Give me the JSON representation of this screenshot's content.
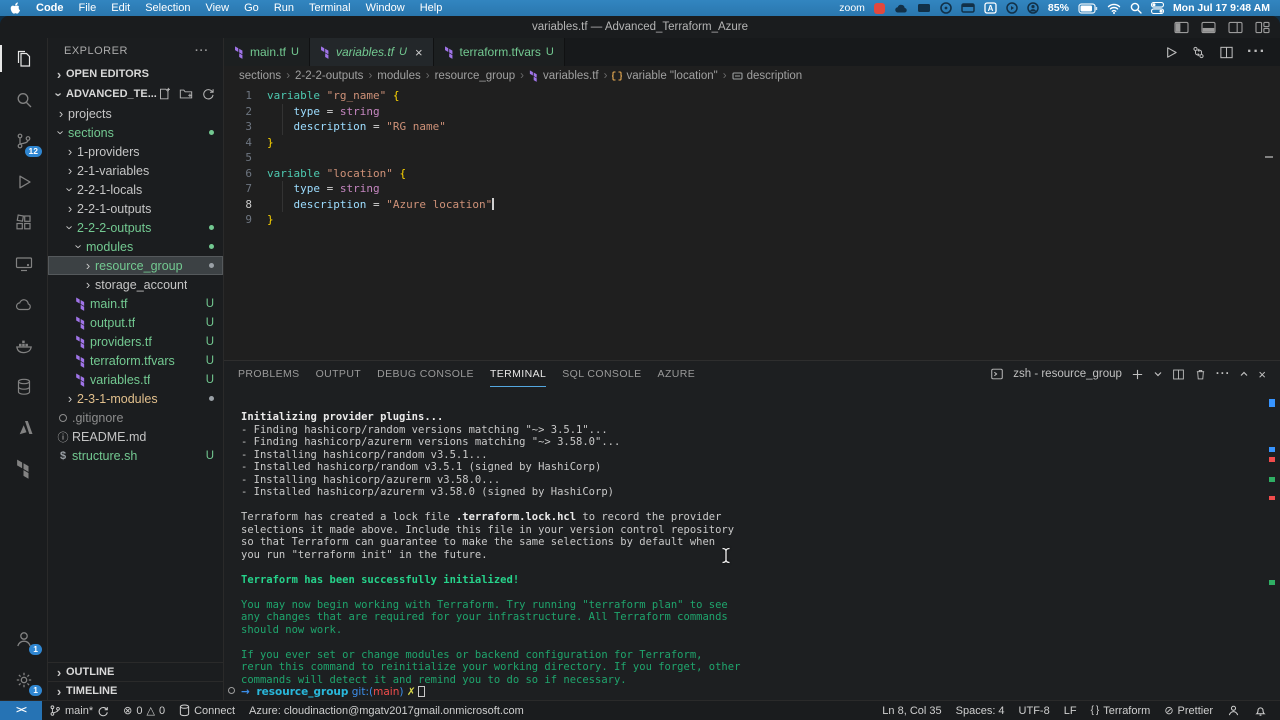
{
  "menubar": {
    "items": [
      "Code",
      "File",
      "Edit",
      "Selection",
      "View",
      "Go",
      "Run",
      "Terminal",
      "Window",
      "Help"
    ],
    "zoom_label": "zoom",
    "battery_label": "85%",
    "datetime": "Mon Jul 17 9:48 AM"
  },
  "titlebar": {
    "title": "variables.tf — Advanced_Terraform_Azure"
  },
  "tabs": [
    {
      "label": "main.tf",
      "badge": "U",
      "active": false
    },
    {
      "label": "variables.tf",
      "badge": "U",
      "active": true,
      "close": "×"
    },
    {
      "label": "terraform.tfvars",
      "badge": "U",
      "active": false
    }
  ],
  "breadcrumbs": [
    {
      "label": "sections"
    },
    {
      "label": "2-2-2-outputs"
    },
    {
      "label": "modules"
    },
    {
      "label": "resource_group"
    },
    {
      "label": "variables.tf",
      "icon": "terraform"
    },
    {
      "label": "variable \"location\"",
      "icon": "symbol-block"
    },
    {
      "label": "description",
      "icon": "symbol-field"
    }
  ],
  "editor": {
    "lines": [
      {
        "n": 1,
        "segs": [
          [
            "variable",
            "kw"
          ],
          [
            " "
          ],
          [
            "\"rg_name\"",
            "str"
          ],
          [
            " "
          ],
          [
            "{",
            "brace"
          ]
        ]
      },
      {
        "n": 2,
        "segs": [
          [
            "    "
          ],
          [
            "type",
            "prop"
          ],
          [
            " = ",
            "op"
          ],
          [
            "string",
            "typ"
          ]
        ]
      },
      {
        "n": 3,
        "segs": [
          [
            "    "
          ],
          [
            "description",
            "prop"
          ],
          [
            " = ",
            "op"
          ],
          [
            "\"RG name\"",
            "str"
          ]
        ]
      },
      {
        "n": 4,
        "segs": [
          [
            "}",
            "brace"
          ]
        ]
      },
      {
        "n": 5,
        "segs": []
      },
      {
        "n": 6,
        "segs": [
          [
            "variable",
            "kw"
          ],
          [
            " "
          ],
          [
            "\"location\"",
            "str"
          ],
          [
            " "
          ],
          [
            "{",
            "brace"
          ]
        ]
      },
      {
        "n": 7,
        "segs": [
          [
            "    "
          ],
          [
            "type",
            "prop"
          ],
          [
            " = ",
            "op"
          ],
          [
            "string",
            "typ"
          ]
        ]
      },
      {
        "n": 8,
        "segs": [
          [
            "    "
          ],
          [
            "description",
            "prop"
          ],
          [
            " = ",
            "op"
          ],
          [
            "\"Azure location\"",
            "str"
          ]
        ],
        "active": true
      },
      {
        "n": 9,
        "segs": [
          [
            "}",
            "brace"
          ]
        ]
      }
    ]
  },
  "explorer": {
    "title": "EXPLORER",
    "more": "···",
    "open_editors": "OPEN EDITORS",
    "workspace": "ADVANCED_TE...",
    "outline": "OUTLINE",
    "timeline": "TIMELINE",
    "tree": [
      {
        "label": "projects",
        "kind": "folder",
        "lvl": 0,
        "expanded": false
      },
      {
        "label": "sections",
        "kind": "folder",
        "lvl": 0,
        "expanded": true,
        "color": "g",
        "dot": "g"
      },
      {
        "label": "1-providers",
        "kind": "folder",
        "lvl": 1,
        "expanded": false
      },
      {
        "label": "2-1-variables",
        "kind": "folder",
        "lvl": 1,
        "expanded": false
      },
      {
        "label": "2-2-1-locals",
        "kind": "folder",
        "lvl": 1,
        "expanded": true
      },
      {
        "label": "2-2-1-outputs",
        "kind": "folder",
        "lvl": 1,
        "expanded": false
      },
      {
        "label": "2-2-2-outputs",
        "kind": "folder",
        "lvl": 1,
        "expanded": true,
        "color": "g",
        "dot": "g"
      },
      {
        "label": "modules",
        "kind": "folder",
        "lvl": 2,
        "expanded": true,
        "color": "g",
        "dot": "g"
      },
      {
        "label": "resource_group",
        "kind": "folder",
        "lvl": 3,
        "expanded": false,
        "color": "g",
        "dot": "gr",
        "selected": true
      },
      {
        "label": "storage_account",
        "kind": "folder",
        "lvl": 3,
        "expanded": false
      },
      {
        "label": "main.tf",
        "kind": "tf",
        "lvl": 2,
        "color": "g",
        "u": "U"
      },
      {
        "label": "output.tf",
        "kind": "tf",
        "lvl": 2,
        "color": "g",
        "u": "U"
      },
      {
        "label": "providers.tf",
        "kind": "tf",
        "lvl": 2,
        "color": "g",
        "u": "U"
      },
      {
        "label": "terraform.tfvars",
        "kind": "tf",
        "lvl": 2,
        "color": "g",
        "u": "U"
      },
      {
        "label": "variables.tf",
        "kind": "tf",
        "lvl": 2,
        "color": "g",
        "u": "U"
      },
      {
        "label": "2-3-1-modules",
        "kind": "folder",
        "lvl": 1,
        "expanded": false,
        "color": "y",
        "dot": "gr"
      },
      {
        "label": ".gitignore",
        "kind": "git",
        "lvl": 0,
        "color": "gr"
      },
      {
        "label": "README.md",
        "kind": "info",
        "lvl": 0
      },
      {
        "label": "structure.sh",
        "kind": "sh",
        "lvl": 0,
        "color": "g",
        "u": "U"
      }
    ]
  },
  "panel": {
    "tabs": [
      {
        "label": "PROBLEMS"
      },
      {
        "label": "OUTPUT"
      },
      {
        "label": "DEBUG CONSOLE"
      },
      {
        "label": "TERMINAL",
        "active": true
      },
      {
        "label": "SQL CONSOLE"
      },
      {
        "label": "AZURE"
      }
    ],
    "shell_label": "zsh - resource_group"
  },
  "terminal": {
    "lines": [
      {
        "segs": [
          [
            "Initializing provider plugins...",
            "tb"
          ]
        ]
      },
      {
        "segs": [
          [
            "- Finding hashicorp/random versions matching \"~> 3.5.1\"..."
          ]
        ]
      },
      {
        "segs": [
          [
            "- Finding hashicorp/azurerm versions matching \"~> 3.58.0\"..."
          ]
        ]
      },
      {
        "segs": [
          [
            "- Installing hashicorp/random v3.5.1..."
          ]
        ]
      },
      {
        "segs": [
          [
            "- Installed hashicorp/random v3.5.1 (signed by HashiCorp)"
          ]
        ]
      },
      {
        "segs": [
          [
            "- Installing hashicorp/azurerm v3.58.0..."
          ]
        ]
      },
      {
        "segs": [
          [
            "- Installed hashicorp/azurerm v3.58.0 (signed by HashiCorp)"
          ]
        ]
      },
      {
        "segs": []
      },
      {
        "segs": [
          [
            "Terraform has created a lock file "
          ],
          [
            ".terraform.lock.hcl",
            "tb"
          ],
          [
            " to record the provider"
          ]
        ]
      },
      {
        "segs": [
          [
            "selections it made above. Include this file in your version control repository"
          ]
        ]
      },
      {
        "segs": [
          [
            "so that Terraform can guarantee to make the same selections by default when"
          ]
        ]
      },
      {
        "segs": [
          [
            "you run \"terraform init\" in the future."
          ]
        ]
      },
      {
        "segs": []
      },
      {
        "segs": [
          [
            "Terraform has been successfully initialized!",
            "tgb"
          ]
        ]
      },
      {
        "segs": []
      },
      {
        "segs": [
          [
            "You may now begin working with Terraform. Try running \"terraform plan\" to see",
            "tg"
          ]
        ]
      },
      {
        "segs": [
          [
            "any changes that are required for your infrastructure. All Terraform commands",
            "tg"
          ]
        ]
      },
      {
        "segs": [
          [
            "should now work.",
            "tg"
          ]
        ]
      },
      {
        "segs": []
      },
      {
        "segs": [
          [
            "If you ever set or change modules or backend configuration for Terraform,",
            "tg"
          ]
        ]
      },
      {
        "segs": [
          [
            "rerun this command to reinitialize your working directory. If you forget, other",
            "tg"
          ]
        ]
      },
      {
        "segs": [
          [
            "commands will detect it and remind you to do so if necessary.",
            "tg"
          ]
        ]
      }
    ],
    "prompt": [
      [
        "→",
        "parrow"
      ],
      [
        "  "
      ],
      [
        "resource_group",
        "pcwd"
      ],
      [
        " "
      ],
      [
        "git:(",
        "pgit"
      ],
      [
        "main",
        "pbr"
      ],
      [
        ")",
        "pgit"
      ],
      [
        " "
      ],
      [
        "✗",
        "pdirty"
      ]
    ]
  },
  "statusbar": {
    "remote": "><",
    "branch": "main*",
    "errors": "0",
    "warnings": "0",
    "connect": "Connect",
    "azure": "Azure: cloudinaction@mgatv2017gmail.onmicrosoft.com",
    "ln_col": "Ln 8, Col 35",
    "spaces": "Spaces: 4",
    "encoding": "UTF-8",
    "eol": "LF",
    "lang": "Terraform",
    "prettier": "Prettier"
  },
  "badges": {
    "scm": "12",
    "accounts": "1",
    "settings": "1"
  }
}
